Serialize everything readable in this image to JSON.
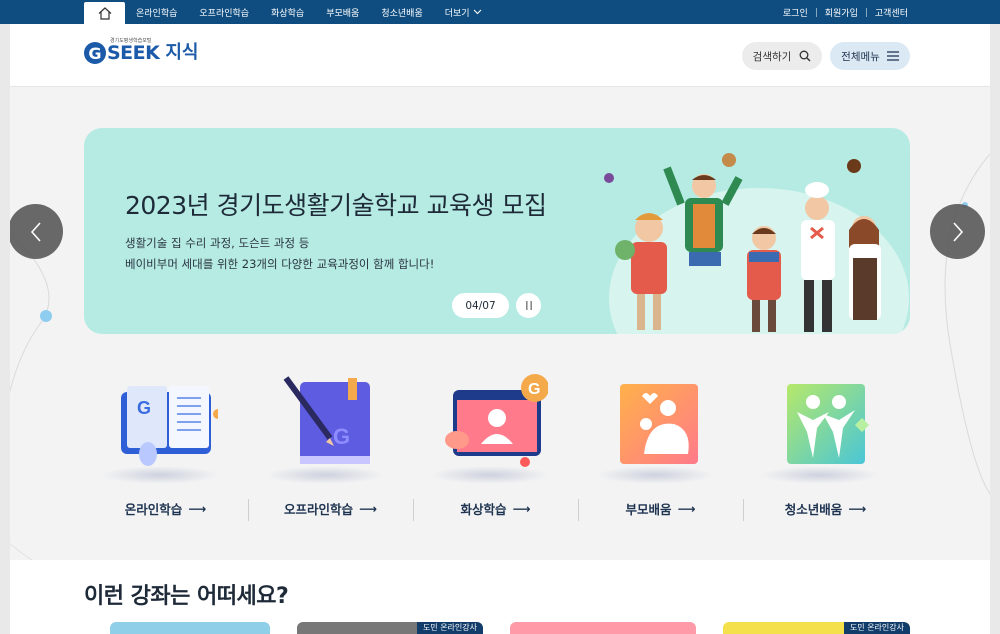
{
  "topnav": {
    "home_icon": "home-icon",
    "items": [
      "온라인학습",
      "오프라인학습",
      "화상학습",
      "부모배움",
      "청소년배움"
    ],
    "more": "더보기",
    "util": [
      "로그인",
      "회원가입",
      "고객센터"
    ]
  },
  "header": {
    "logo_word": "SEEK",
    "logo_ko": "지식",
    "logo_small": "경기도평생학습포털",
    "search_label": "검색하기",
    "menu_label": "전체메뉴"
  },
  "banner": {
    "title": "2023년 경기도생활기술학교 교육생 모집",
    "sub_line1": "생활기술 집 수리 과정, 도슨트 과정 등",
    "sub_line2": "베이비부머 세대를 위한 23개의 다양한 교육과정이 함께 합니다!",
    "pager": "04/07",
    "colors": {
      "bg": "#b5ebe3",
      "accent": "#1a5aa8"
    }
  },
  "categories": [
    {
      "label": "온라인학습",
      "icon": "online-book-icon"
    },
    {
      "label": "오프라인학습",
      "icon": "offline-book-icon"
    },
    {
      "label": "화상학습",
      "icon": "video-call-icon"
    },
    {
      "label": "부모배움",
      "icon": "parent-child-icon"
    },
    {
      "label": "청소년배움",
      "icon": "youth-icon"
    }
  ],
  "recommend": {
    "title": "이런 강좌는 어떠세요?",
    "badge": "도민 온라인강사"
  }
}
